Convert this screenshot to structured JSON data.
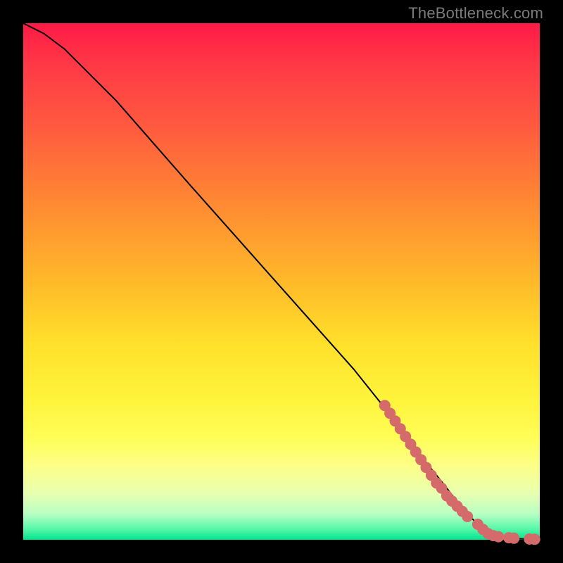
{
  "watermark": "TheBottleneck.com",
  "colors": {
    "dot": "#d46a6a",
    "line": "#000000",
    "frame": "#000000"
  },
  "chart_data": {
    "type": "line",
    "title": "",
    "xlabel": "",
    "ylabel": "",
    "xlim": [
      0,
      100
    ],
    "ylim": [
      0,
      100
    ],
    "grid": false,
    "legend": false,
    "series": [
      {
        "name": "curve",
        "kind": "line",
        "x": [
          0,
          4,
          8,
          12,
          18,
          25,
          32,
          40,
          48,
          56,
          64,
          72,
          78,
          82,
          85,
          88,
          90,
          92,
          94,
          96,
          98,
          100
        ],
        "y": [
          100,
          98,
          95,
          91,
          85,
          77,
          69,
          60,
          51,
          42,
          33,
          23,
          15,
          10,
          6,
          3,
          1.5,
          0.8,
          0.4,
          0.2,
          0.1,
          0.05
        ]
      },
      {
        "name": "points",
        "kind": "scatter",
        "x": [
          70,
          71,
          72,
          73,
          74,
          75,
          76,
          77,
          78,
          79,
          80,
          81,
          82,
          83,
          84,
          85,
          86,
          88,
          89,
          90,
          91,
          92,
          94,
          95,
          98,
          99
        ],
        "y": [
          26,
          24.5,
          23,
          21.5,
          20,
          18.5,
          17,
          15.5,
          14,
          12.5,
          11,
          10,
          8.5,
          7.5,
          6.5,
          5.5,
          4.5,
          3,
          2,
          1.2,
          0.8,
          0.6,
          0.4,
          0.3,
          0.15,
          0.1
        ]
      }
    ]
  }
}
